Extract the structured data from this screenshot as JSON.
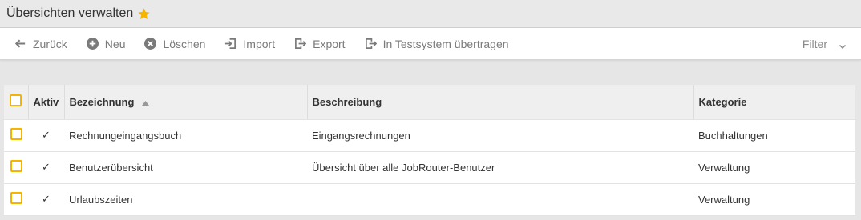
{
  "header": {
    "title": "Übersichten verwalten",
    "favorite_icon": "star-icon",
    "favorite_color": "#f5b400"
  },
  "toolbar": {
    "back_label": "Zurück",
    "new_label": "Neu",
    "delete_label": "Löschen",
    "import_label": "Import",
    "export_label": "Export",
    "transfer_label": "In Testsystem übertragen",
    "filter_label": "Filter"
  },
  "table": {
    "columns": {
      "active": "Aktiv",
      "name": "Bezeichnung",
      "description": "Beschreibung",
      "category": "Kategorie"
    },
    "sort_column": "Bezeichnung",
    "sort_direction": "ascending",
    "rows": [
      {
        "active": "✓",
        "name": "Rechnungeingangsbuch",
        "description": "Eingangsrechnungen",
        "category": "Buchhaltungen"
      },
      {
        "active": "✓",
        "name": "Benutzerübersicht",
        "description": "Übersicht über alle JobRouter-Benutzer",
        "category": "Verwaltung"
      },
      {
        "active": "✓",
        "name": "Urlaubszeiten",
        "description": "",
        "category": "Verwaltung"
      }
    ]
  },
  "colors": {
    "checkbox_border": "#f5b400",
    "toolbar_text": "#7a7a7a"
  }
}
